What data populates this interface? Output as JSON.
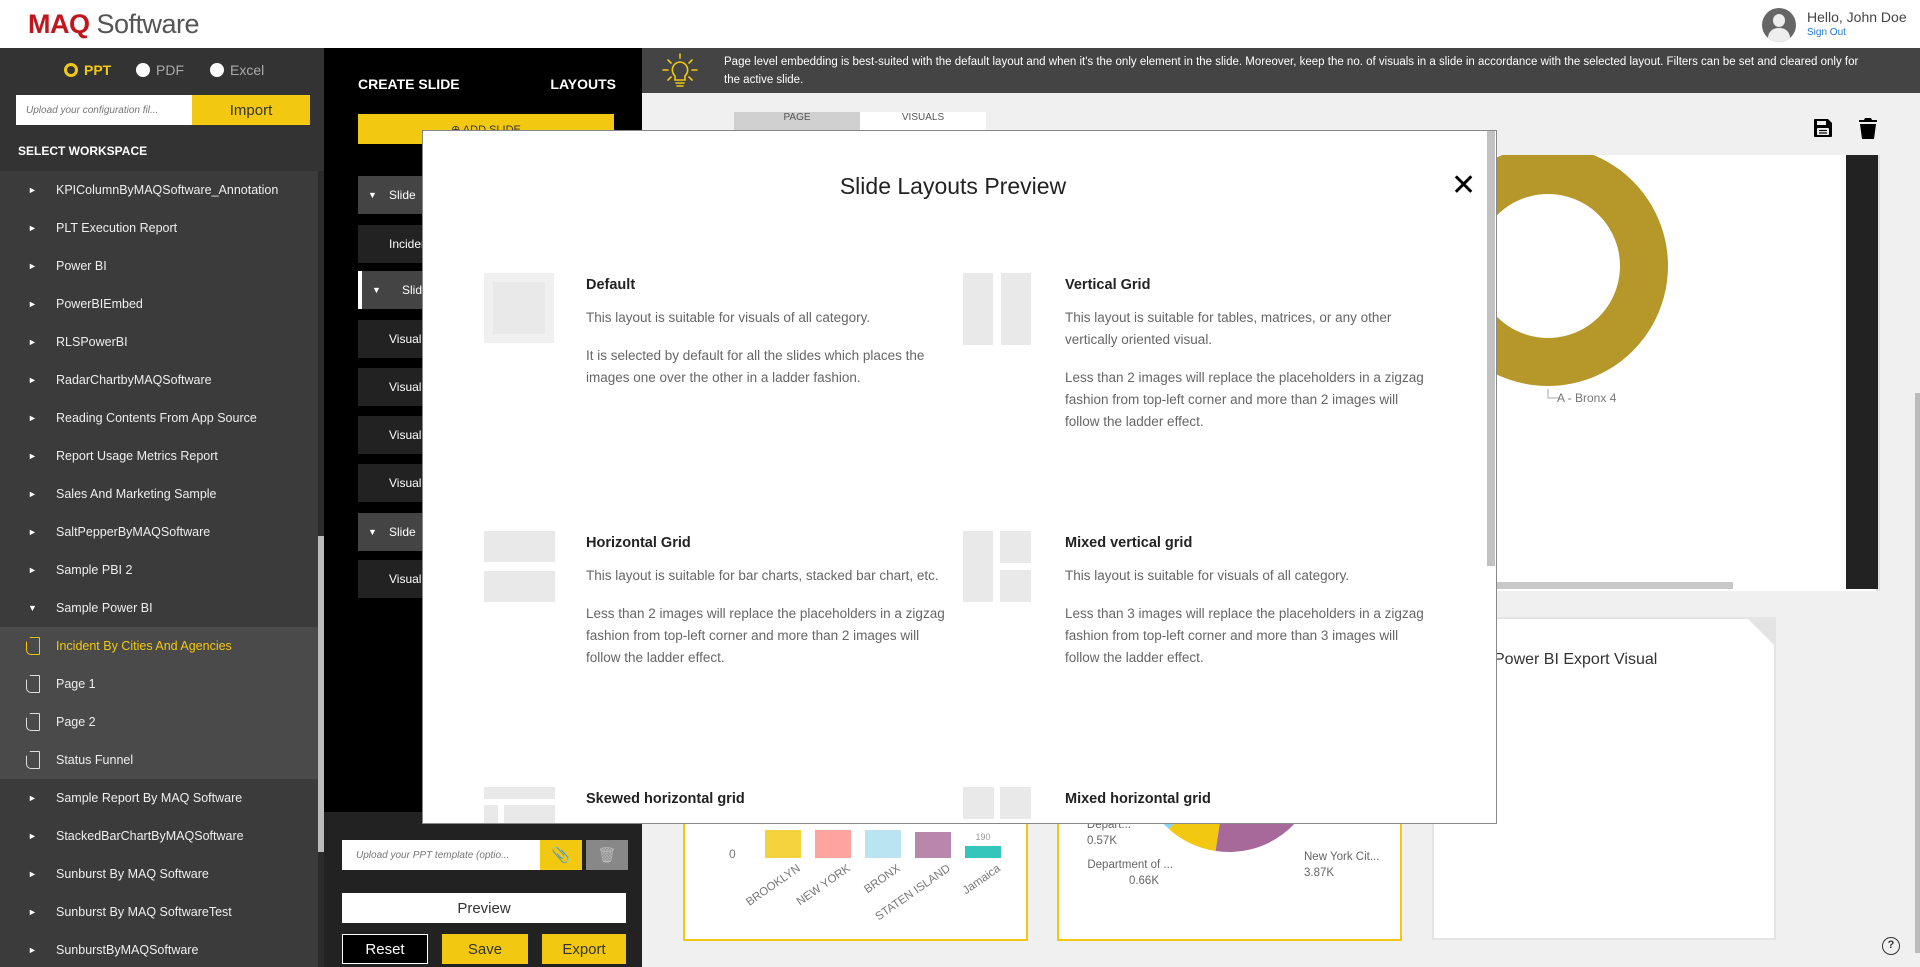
{
  "header": {
    "logo_brand": "MAQ",
    "logo_product": " Software",
    "greeting": "Hello, John Doe",
    "sign_out": "Sign Out"
  },
  "sidebar": {
    "formats": [
      {
        "label": "PPT",
        "selected": true
      },
      {
        "label": "PDF",
        "selected": false
      },
      {
        "label": "Excel",
        "selected": false
      }
    ],
    "config_placeholder": "Upload your configuration fil...",
    "import_label": "Import",
    "workspace_title": "SELECT WORKSPACE",
    "workspaces": [
      {
        "label": "KPIColumnByMAQSoftware_Annotation",
        "type": "workspace",
        "expanded": false
      },
      {
        "label": "PLT Execution Report",
        "type": "workspace",
        "expanded": false
      },
      {
        "label": "Power BI",
        "type": "workspace",
        "expanded": false
      },
      {
        "label": "PowerBIEmbed",
        "type": "workspace",
        "expanded": false
      },
      {
        "label": "RLSPowerBI",
        "type": "workspace",
        "expanded": false
      },
      {
        "label": "RadarChartbyMAQSoftware",
        "type": "workspace",
        "expanded": false
      },
      {
        "label": "Reading Contents From App Source",
        "type": "workspace",
        "expanded": false
      },
      {
        "label": "Report Usage Metrics Report",
        "type": "workspace",
        "expanded": false
      },
      {
        "label": "Sales And Marketing Sample",
        "type": "workspace",
        "expanded": false
      },
      {
        "label": "SaltPepperByMAQSoftware",
        "type": "workspace",
        "expanded": false
      },
      {
        "label": "Sample PBI 2",
        "type": "workspace",
        "expanded": false
      },
      {
        "label": "Sample Power BI",
        "type": "workspace",
        "expanded": true
      },
      {
        "label": "Incident By Cities And Agencies",
        "type": "page",
        "active": true
      },
      {
        "label": "Page 1",
        "type": "page",
        "active": false
      },
      {
        "label": "Page 2",
        "type": "page",
        "active": false
      },
      {
        "label": "Status Funnel",
        "type": "page",
        "active": false
      },
      {
        "label": "Sample Report By MAQ Software",
        "type": "workspace",
        "expanded": false
      },
      {
        "label": "StackedBarChartByMAQSoftware",
        "type": "workspace",
        "expanded": false
      },
      {
        "label": "Sunburst By MAQ Software",
        "type": "workspace",
        "expanded": false
      },
      {
        "label": "Sunburst By MAQ SoftwareTest",
        "type": "workspace",
        "expanded": false
      },
      {
        "label": "SunburstByMAQSoftware",
        "type": "workspace",
        "expanded": false
      }
    ]
  },
  "panel": {
    "create_title": "CREATE SLIDE",
    "layouts_label": "LAYOUTS",
    "add_slide_label": "ADD SLIDE",
    "rows": [
      {
        "label": "Slide",
        "kind": "group"
      },
      {
        "label": "Inciden",
        "kind": "sub"
      },
      {
        "label": "Slid",
        "kind": "group-marked"
      },
      {
        "label": "Visual",
        "kind": "sub"
      },
      {
        "label": "Visual",
        "kind": "sub"
      },
      {
        "label": "Visual",
        "kind": "sub"
      },
      {
        "label": "Visual",
        "kind": "sub"
      },
      {
        "label": "Slide",
        "kind": "group"
      },
      {
        "label": "Visual",
        "kind": "sub"
      }
    ],
    "template_placeholder": "Upload your PPT template (optio...",
    "preview_label": "Preview",
    "reset_label": "Reset",
    "save_label": "Save",
    "export_label": "Export"
  },
  "main": {
    "info_text": "Page level embedding is best-suited with the default layout and when it's the only element in the slide. Moreover, keep the no. of visuals in a slide in accordance with the selected layout. Filters can be set and cleared only for the active slide.",
    "tabs": [
      "PAGE",
      "VISUALS"
    ],
    "donut_top_label": "A - Bronx 4",
    "export_visual_title": "Power BI Export Visual",
    "help_label": "?"
  },
  "modal": {
    "title": "Slide Layouts Preview",
    "close_label": "✕",
    "layouts": [
      {
        "name": "Default",
        "desc": [
          "This layout is suitable for visuals of all category.",
          "It is selected by default for all the slides which places the images one over the other in a ladder fashion."
        ]
      },
      {
        "name": "Vertical Grid",
        "desc": [
          "This layout is suitable for tables, matrices, or any other vertically oriented visual.",
          "Less than 2 images will replace the placeholders in a zigzag fashion from top-left corner and more than 2 images will follow the ladder effect."
        ]
      },
      {
        "name": "Horizontal Grid",
        "desc": [
          "This layout is suitable for bar charts, stacked bar chart, etc.",
          "Less than 2 images will replace the placeholders in a zigzag fashion from top-left corner and more than 2 images will follow the ladder effect."
        ]
      },
      {
        "name": "Mixed vertical grid",
        "desc": [
          "This layout is suitable for visuals of all category.",
          "Less than 3 images will replace the placeholders in a zigzag fashion from top-left corner and more than 3 images will follow the ladder effect."
        ]
      },
      {
        "name": "Skewed horizontal grid",
        "desc": []
      },
      {
        "name": "Mixed horizontal grid",
        "desc": []
      }
    ]
  },
  "chart_data": [
    {
      "type": "bar",
      "title": "",
      "categories": [
        "BROOKLYN",
        "NEW YORK",
        "BRONX",
        "STATEN ISLAND",
        "Jamaica"
      ],
      "colors": [
        "#f5d33f",
        "#fda4a1",
        "#bbe4f1",
        "#b887ab",
        "#35c6bb"
      ],
      "y_tick_labels": [
        "0"
      ],
      "data_labels": [
        "",
        "",
        "",
        "",
        "190"
      ],
      "note": "partially visible, upper portion hidden behind modal"
    },
    {
      "type": "pie",
      "title": "",
      "slices": [
        {
          "label": "Depart...",
          "value_label": "0.57K",
          "value": 570,
          "color": "#88d4ee"
        },
        {
          "label": "Department of ...",
          "value_label": "0.66K",
          "value": 660,
          "color": "#f2c811"
        },
        {
          "label": "New York Cit...",
          "value_label": "3.87K",
          "value": 3870,
          "color": "#a66999"
        }
      ]
    },
    {
      "type": "pie",
      "title": "",
      "slices": [
        {
          "label": "A - Bronx 4",
          "color": "#b5972a"
        }
      ]
    }
  ]
}
